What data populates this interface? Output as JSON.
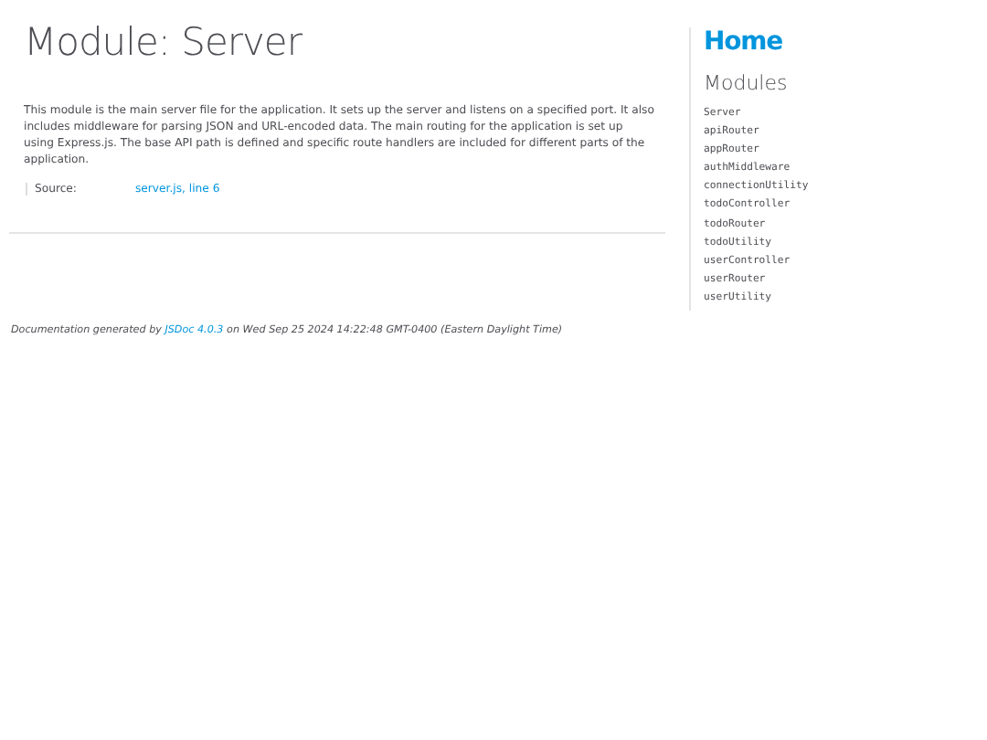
{
  "main": {
    "title": "Module: Server",
    "description": "This module is the main server file for the application. It sets up the server and listens on a specified port. It also includes middleware for parsing JSON and URL-encoded data. The main routing for the application is set up using Express.js. The base API path is defined and specific route handlers are included for different parts of the application.",
    "details": [
      {
        "label": "Source:",
        "link": "server.js, line 6"
      }
    ]
  },
  "footer": {
    "before": "Documentation generated by ",
    "link": "JSDoc 4.0.3",
    "after": " on Wed Sep 25 2024 14:22:48 GMT-0400 (Eastern Daylight Time)"
  },
  "nav": {
    "home": "Home",
    "heading": "Modules",
    "items": [
      {
        "label": "Server"
      },
      {
        "label": "apiRouter"
      },
      {
        "label": "appRouter"
      },
      {
        "label": "authMiddleware"
      },
      {
        "label": "connectionUtility"
      },
      {
        "label": "todoController"
      },
      {
        "label": "todoRouter"
      },
      {
        "label": "todoUtility"
      },
      {
        "label": "userController"
      },
      {
        "label": "userRouter"
      },
      {
        "label": "userUtility"
      }
    ]
  }
}
